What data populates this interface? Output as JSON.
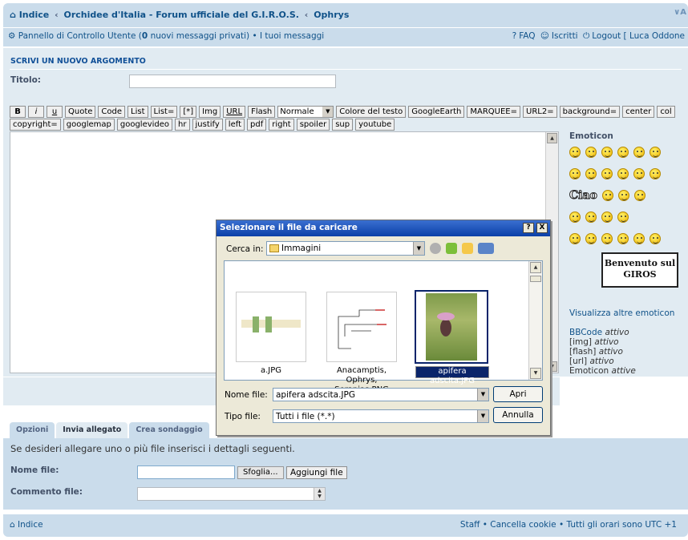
{
  "topbar": {
    "crumbs": [
      "Indice",
      "Orchidee d'Italia - Forum ufficiale del G.I.R.O.S.",
      "Ophrys"
    ],
    "sep": "‹",
    "fontsize": "A"
  },
  "navbar": {
    "ucp": "Pannello di Controllo Utente (",
    "ucp_count": "0",
    "ucp_tail": " nuovi messaggi privati)",
    "bullet": "•",
    "my_messages": "I tuoi messaggi",
    "faq": "FAQ",
    "iscritti": "Iscritti",
    "logout": "Logout [ Luca Oddone"
  },
  "post": {
    "heading": "SCRIVI UN NUOVO ARGOMENTO",
    "title_label": "Titolo:",
    "title_value": ""
  },
  "bbcode_row1": [
    "B",
    "i",
    "u",
    "Quote",
    "Code",
    "List",
    "List=",
    "[*]",
    "Img",
    "URL",
    "Flash"
  ],
  "font_size": "Normale",
  "bbcode_row1b": [
    "Colore del testo",
    "GoogleEarth",
    "MARQUEE=",
    "URL2=",
    "background=",
    "center",
    "col"
  ],
  "bbcode_row2": [
    "copyright=",
    "googlemap",
    "googlevideo",
    "hr",
    "justify",
    "left",
    "pdf",
    "right",
    "spoiler",
    "sup",
    "youtube"
  ],
  "emoticons": {
    "title": "Emoticon",
    "ciao": "Ciao",
    "sign": "Benvenuto sul GIROS",
    "more": "Visualizza altre emoticon"
  },
  "codes": {
    "bbcode": "BBCode",
    "bbcode_s": "attivo",
    "img": "[img]",
    "img_s": "attivo",
    "flash": "[flash]",
    "flash_s": "attivo",
    "url": "[url]",
    "url_s": "attivo",
    "emot": "Emoticon",
    "emot_s": "attive"
  },
  "tabs": [
    "Opzioni",
    "Invia allegato",
    "Crea sondaggio"
  ],
  "attach": {
    "msg": "Se desideri allegare uno o più file inserisci i dettagli seguenti.",
    "file_label": "Nome file:",
    "browse": "Sfoglia...",
    "add": "Aggiungi file",
    "comment_label": "Commento file:"
  },
  "footer": {
    "index": "Indice",
    "staff": "Staff",
    "delete_cookies": "Cancella cookie",
    "timezone": "Tutti gli orari sono UTC +1",
    "bullet": "•"
  },
  "dialog": {
    "title": "Selezionare il file da caricare",
    "help": "?",
    "close": "X",
    "lookin_label": "Cerca in:",
    "lookin_value": "Immagini",
    "files": [
      {
        "name": "a.JPG"
      },
      {
        "name": "Anacamptis, Ophrys, Serapias.PNG"
      },
      {
        "name": "apifera adscita.JPG"
      }
    ],
    "filename_label": "Nome file:",
    "filename_value": "apifera adscita.JPG",
    "filetype_label": "Tipo file:",
    "filetype_value": "Tutti i file (*.*)",
    "open": "Apri",
    "cancel": "Annulla"
  },
  "colors": {
    "bar": "#cadceb",
    "panel": "#e1ebf2",
    "link": "#105289",
    "dialog_title": "#0a3fa8",
    "selection": "#0a246a"
  }
}
